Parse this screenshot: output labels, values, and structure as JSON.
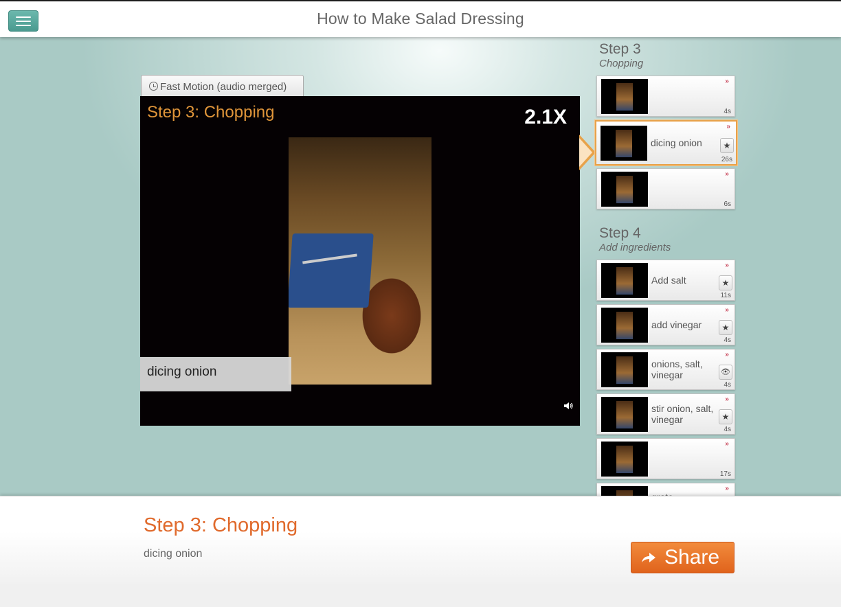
{
  "header": {
    "title": "How to Make Salad Dressing",
    "menu_icon": "hamburger-menu-icon"
  },
  "player": {
    "mode_tab": "Fast Motion (audio merged)",
    "overlay_title": "Step 3: Chopping",
    "speed": "2.1X",
    "caption": "dicing onion"
  },
  "steps": [
    {
      "number": "Step 3",
      "subtitle": "Chopping",
      "clips": [
        {
          "label": "",
          "duration": "4s",
          "badge": ""
        },
        {
          "label": "dicing onion",
          "duration": "26s",
          "badge": "★",
          "selected": true
        },
        {
          "label": "",
          "duration": "6s",
          "badge": ""
        }
      ]
    },
    {
      "number": "Step 4",
      "subtitle": "Add ingredients",
      "clips": [
        {
          "label": "Add salt",
          "duration": "11s",
          "badge": "★"
        },
        {
          "label": "add vinegar",
          "duration": "4s",
          "badge": "★"
        },
        {
          "label": "onions, salt, vinegar",
          "duration": "4s",
          "badge": "👁"
        },
        {
          "label": "stir onion, salt, vinegar",
          "duration": "4s",
          "badge": "★"
        },
        {
          "label": "",
          "duration": "17s",
          "badge": ""
        },
        {
          "label": "grate",
          "duration": "",
          "badge": ""
        }
      ]
    }
  ],
  "clip_arrow": "››",
  "detail": {
    "title": "Step 3: Chopping",
    "description": "dicing onion",
    "share_label": "Share"
  },
  "colors": {
    "accent": "#e06a2c",
    "teal": "#4a9a8f",
    "selected_border": "#e8a24a"
  }
}
